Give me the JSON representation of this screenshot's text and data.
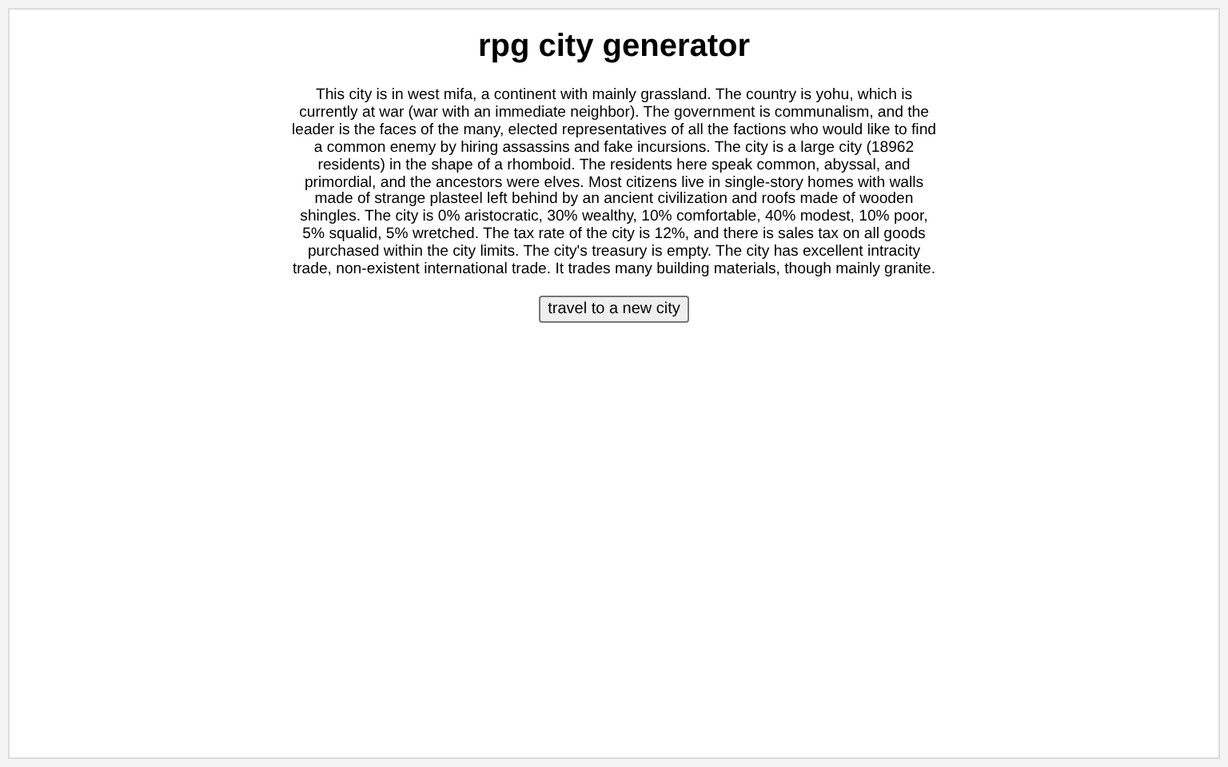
{
  "title": "rpg city generator",
  "description": "This city is in west mifa, a continent with mainly grassland. The country is yohu, which is currently at war (war with an immediate neighbor). The government is communalism, and the leader is the faces of the many, elected representatives of all the factions who would like to find a common enemy by hiring assassins and fake incursions. The city is a large city (18962 residents) in the shape of a rhomboid. The residents here speak common, abyssal, and primordial, and the ancestors were elves. Most citizens live in single-story homes with walls made of strange plasteel left behind by an ancient civilization and roofs made of wooden shingles. The city is 0% aristocratic, 30% wealthy, 10% comfortable, 40% modest, 10% poor, 5% squalid, 5% wretched. The tax rate of the city is 12%, and there is sales tax on all goods purchased within the city limits. The city's treasury is empty. The city has excellent intracity trade, non-existent international trade. It trades many building materials, though mainly granite.",
  "button": "travel to a new city"
}
